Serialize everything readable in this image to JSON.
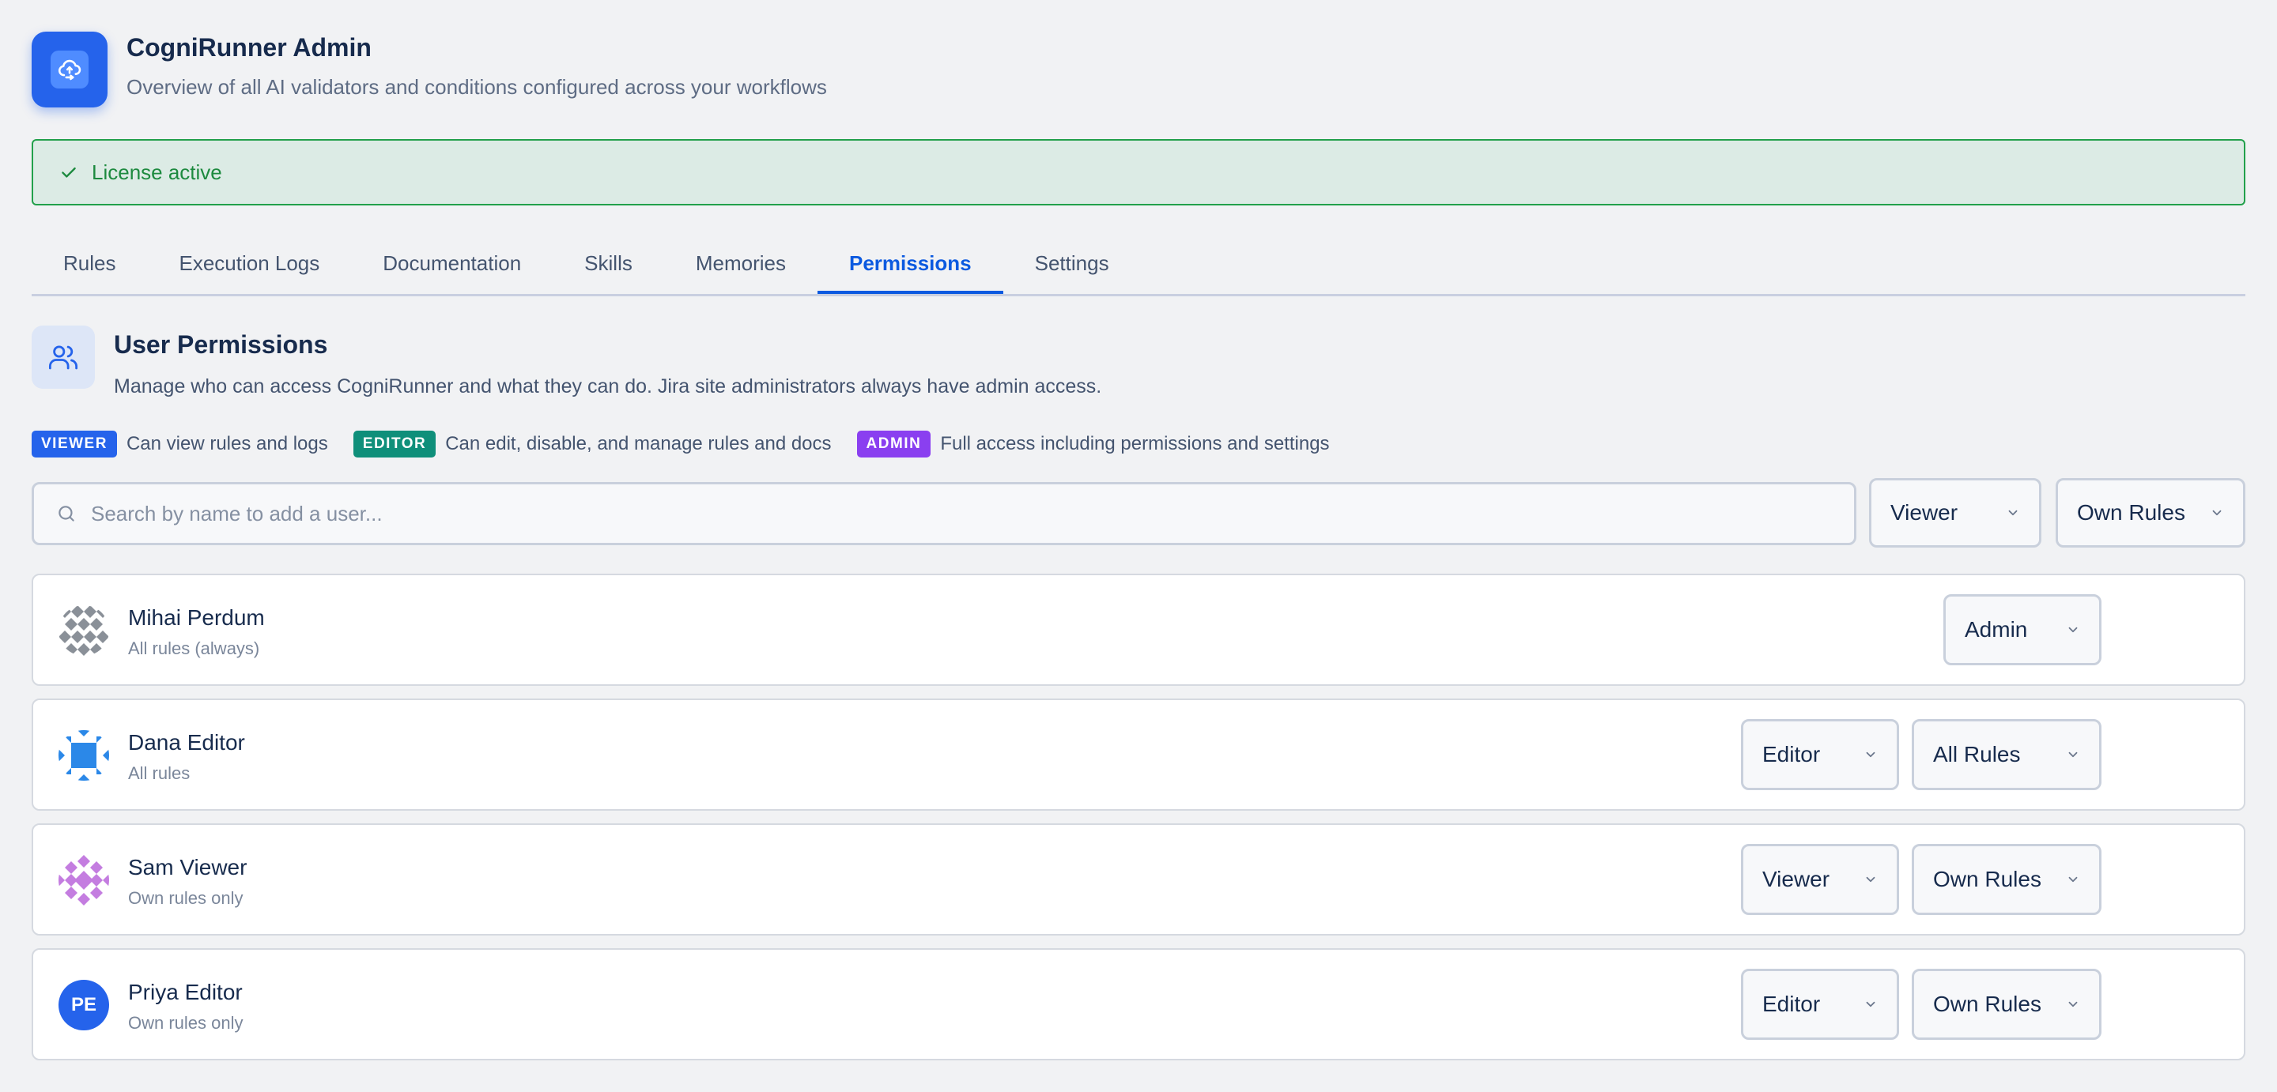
{
  "app": {
    "title": "CogniRunner Admin",
    "subtitle": "Overview of all AI validators and conditions configured across your workflows",
    "logo_icon": "cloud-sync-icon"
  },
  "license": {
    "text": "License active",
    "icon": "check-icon",
    "color": "#1d8a3f"
  },
  "tabs": [
    {
      "label": "Rules"
    },
    {
      "label": "Execution Logs"
    },
    {
      "label": "Documentation"
    },
    {
      "label": "Skills"
    },
    {
      "label": "Memories"
    },
    {
      "label": "Permissions",
      "active": true
    },
    {
      "label": "Settings"
    }
  ],
  "section": {
    "title": "User Permissions",
    "description": "Manage who can access CogniRunner and what they can do. Jira site administrators always have admin access.",
    "icon": "users-icon"
  },
  "roles": [
    {
      "badge": "VIEWER",
      "description": "Can view rules and logs",
      "color": "#2563eb"
    },
    {
      "badge": "EDITOR",
      "description": "Can edit, disable, and manage rules and docs",
      "color": "#0f8f7a"
    },
    {
      "badge": "ADMIN",
      "description": "Full access including permissions and settings",
      "color": "#8a3ff0"
    }
  ],
  "add_user": {
    "search_placeholder": "Search by name to add a user...",
    "role_select": "Viewer",
    "scope_select": "Own Rules"
  },
  "users": [
    {
      "name": "Mihai Perdum",
      "scope_text": "All rules (always)",
      "role": "Admin",
      "scope": null
    },
    {
      "name": "Dana Editor",
      "scope_text": "All rules",
      "role": "Editor",
      "scope": "All Rules"
    },
    {
      "name": "Sam Viewer",
      "scope_text": "Own rules only",
      "role": "Viewer",
      "scope": "Own Rules"
    },
    {
      "name": "Priya Editor",
      "scope_text": "Own rules only",
      "role": "Editor",
      "scope": "Own Rules",
      "initials": "PE"
    }
  ]
}
